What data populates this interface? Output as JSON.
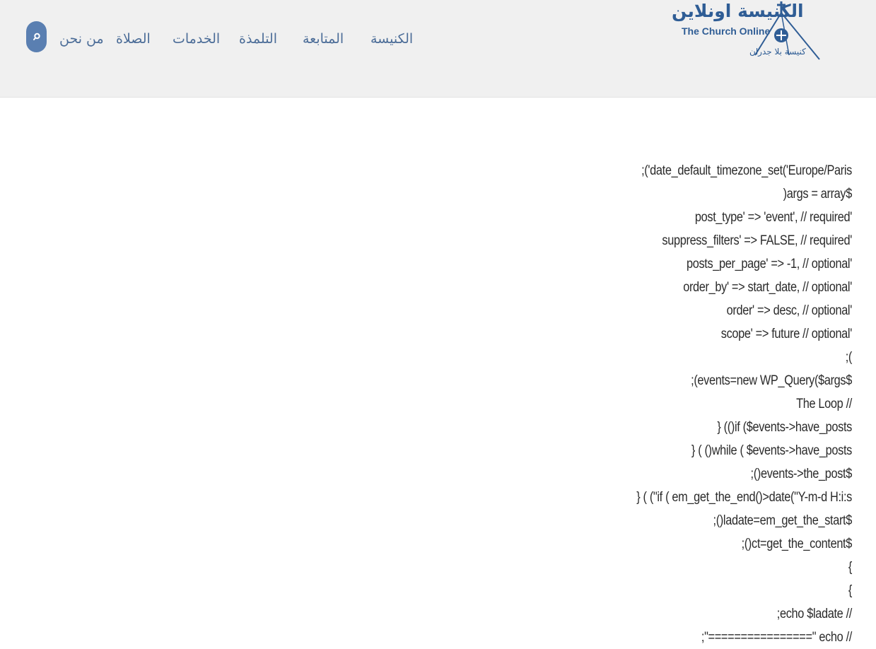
{
  "header": {
    "logo": {
      "arabic": "الكنيسة اونلاين",
      "english": "The Church Online",
      "tagline": "كنيسة بلا جدران"
    },
    "nav": [
      {
        "label": "الكنيسة"
      },
      {
        "label": "المتابعة"
      },
      {
        "label": "التلمذة"
      },
      {
        "label": "الخدمات"
      },
      {
        "label": "الصلاة"
      },
      {
        "label": "من نحن"
      }
    ],
    "search_icon": "search-icon"
  },
  "content": {
    "lines": [
      ";('date_default_timezone_set('Europe/Paris",
      ")args = array$",
      "post_type' => 'event', // required'",
      "suppress_filters' => FALSE, // required'",
      "posts_per_page' => -1, // optional'",
      "order_by' => start_date, // optional'",
      "order' => desc, // optional'",
      "scope' => future // optional'",
      ";(",
      ";(events=new WP_Query($args$",
      "The Loop //",
      "} (()if ($events->have_posts",
      "} ( ()while ( $events->have_posts",
      ";()events->the_post$",
      "} ( (\"if ( em_get_the_end()>date(\"Y-m-d H:i:s",
      ";()ladate=em_get_the_start$",
      ";()ct=get_the_content$",
      "{",
      "{",
      ";echo $ladate //",
      ";\"================\" echo //"
    ]
  },
  "colors": {
    "header_bg": "#f0f0f0",
    "nav_text": "#4c6d98",
    "brand_blue": "#2f5d95",
    "search_bg": "#5a7fb1",
    "code_text": "#2b2b2b"
  }
}
